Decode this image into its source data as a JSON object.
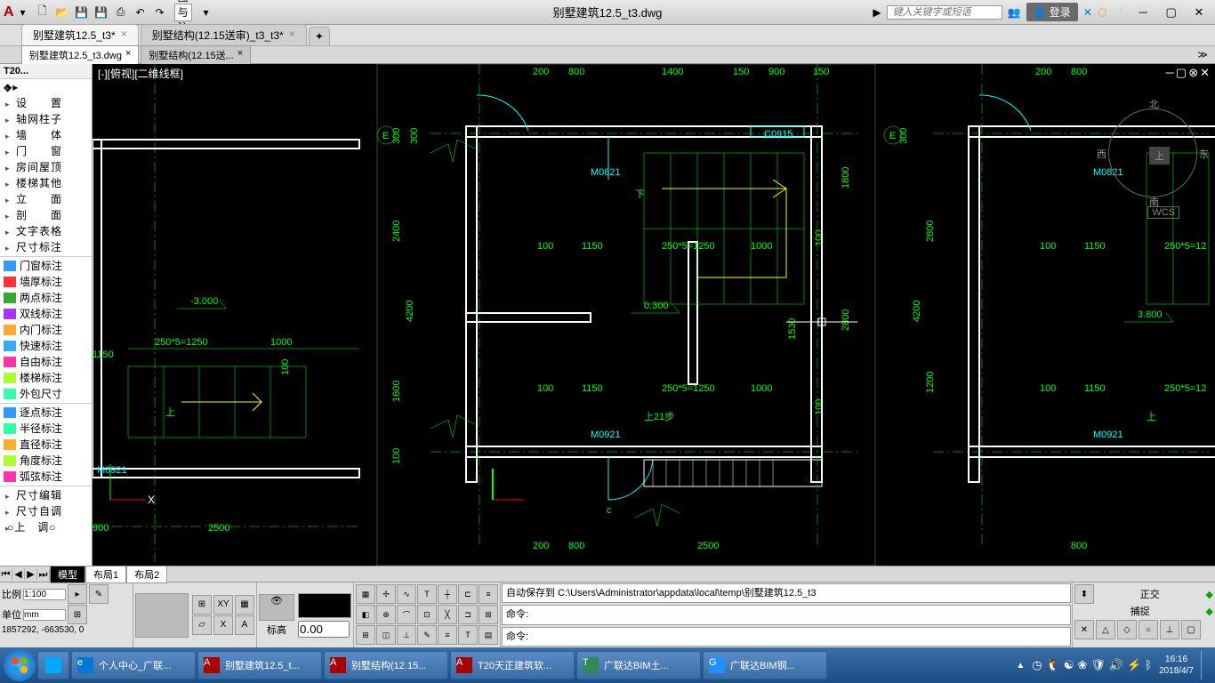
{
  "titlebar": {
    "workspace_dropdown": "草图与注释",
    "title": "别墅建筑12.5_t3.dwg",
    "search_placeholder": "键入关键字或短语",
    "login": "登录"
  },
  "doc_tabs": [
    {
      "label": "别墅建筑12.5_t3*",
      "close": "×",
      "active": true
    },
    {
      "label": "别墅结构(12.15送审)_t3_t3*",
      "close": "×",
      "active": false
    }
  ],
  "file_tabs": [
    {
      "label": "别墅建筑12.5_t3.dwg",
      "close": "×",
      "active": true
    },
    {
      "label": "别墅结构(12.15送...",
      "close": "×",
      "active": false
    }
  ],
  "t20": {
    "title": "T20...",
    "top_items": [
      "设　　置",
      "轴网柱子",
      "墙　　体",
      "门　　窗",
      "房间屋顶",
      "楼梯其他",
      "立　　面",
      "剖　　面",
      "文字表格",
      "尺寸标注"
    ],
    "icon_items": [
      "门窗标注",
      "墙厚标注",
      "两点标注",
      "双线标注",
      "内门标注",
      "快速标注",
      "自由标注",
      "楼梯标注",
      "外包尺寸",
      "逐点标注",
      "半径标注",
      "直径标注",
      "角度标注",
      "弧弦标注"
    ],
    "bot_items": [
      "尺寸编辑",
      "尺寸自调",
      "○上　调○"
    ]
  },
  "drawing": {
    "view_label": "[-][俯视][二维线框]",
    "compass": {
      "n": "北",
      "s": "南",
      "e": "东",
      "w": "西",
      "u": "上"
    },
    "wcs": "WCS",
    "dims": {
      "d200": "200",
      "d800": "800",
      "d1400": "1400",
      "d150": "150",
      "d900": "900",
      "d2400": "2400",
      "d4200": "4200",
      "d1600": "1600",
      "d300": "300",
      "d2500": "2500",
      "d1000": "1000",
      "d100": "100",
      "d1150": "1150",
      "d2800": "2800",
      "d1200": "1200",
      "m0821": "M0821",
      "m0921": "M0921",
      "c0915": "C0915",
      "stair": "250*5=1250",
      "grid_e": "E",
      "elev_neg3": "-3.000",
      "elev_030": "0.300",
      "elev_380": "3.800",
      "up21": "上21步",
      "up": "上",
      "down": "下",
      "c": "c"
    }
  },
  "layout_tabs": {
    "model": "模型",
    "l1": "布局1",
    "l2": "布局2"
  },
  "controls": {
    "scale_label": "比例",
    "scale_value": "1:100",
    "unit_label": "单位",
    "unit_value": "mm",
    "coords": "1857292, -663530, 0",
    "std_label": "标高",
    "input_value": "0.00",
    "cmd_autosave": "自动保存到 C:\\Users\\Administrator\\appdata\\local\\temp\\别墅建筑12.5_t3",
    "cmd_label": "命令:",
    "ortho": "正交",
    "snap": "捕捉"
  },
  "taskbar": {
    "items": [
      {
        "label": "个人中心_广联...",
        "color": "#0078d7"
      },
      {
        "label": "别墅建筑12.5_t...",
        "color": "#a00000"
      },
      {
        "label": "别墅结构(12.15...",
        "color": "#a00000"
      },
      {
        "label": "T20天正建筑软...",
        "color": "#a00000"
      },
      {
        "label": "广联达BIM土...",
        "color": "#2e8b57"
      },
      {
        "label": "广联达BIM钢...",
        "color": "#1e90ff"
      }
    ],
    "time": "16:16",
    "date": "2018/4/7"
  }
}
